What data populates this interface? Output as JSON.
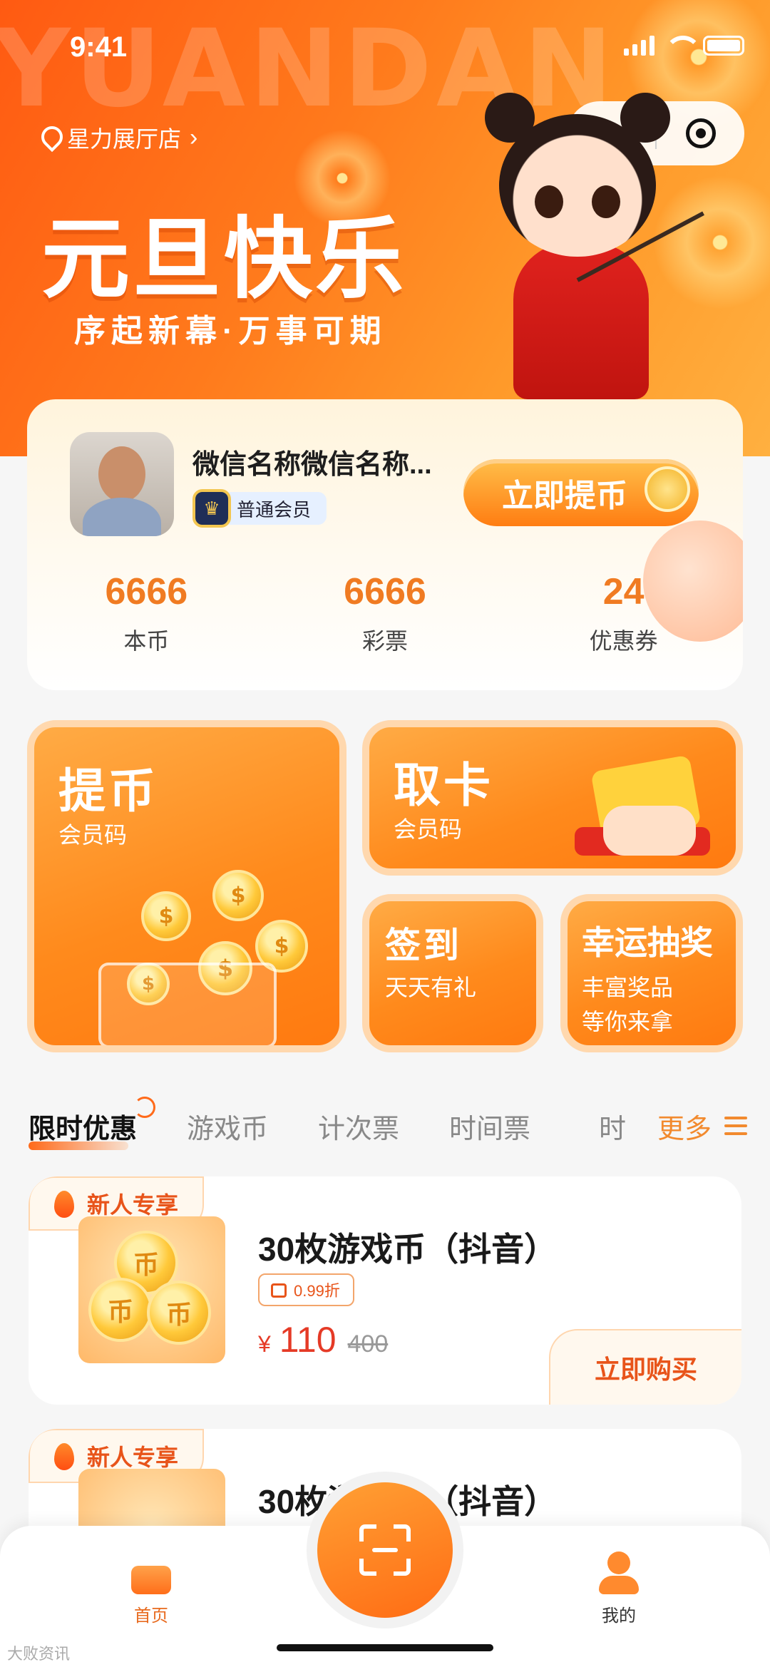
{
  "status_bar": {
    "time": "9:41"
  },
  "hero": {
    "bg_text": "YUANDAN",
    "store_name": "星力展厅店",
    "title": "元旦快乐",
    "subtitle": "序起新幕·万事可期"
  },
  "user": {
    "nickname": "微信名称微信名称...",
    "member_level": "普通会员",
    "withdraw_button": "立即提币",
    "stats": [
      {
        "value": "6666",
        "label": "本币"
      },
      {
        "value": "6666",
        "label": "彩票"
      },
      {
        "value": "24",
        "label": "优惠券"
      }
    ]
  },
  "features": {
    "withdraw": {
      "title": "提币",
      "subtitle": "会员码"
    },
    "card": {
      "title": "取卡",
      "subtitle": "会员码"
    },
    "signin": {
      "title": "签到",
      "subtitle": "天天有礼"
    },
    "lottery": {
      "title": "幸运抽奖",
      "subtitle_line1": "丰富奖品",
      "subtitle_line2": "等你来拿"
    }
  },
  "tabs": {
    "items": [
      "限时优惠",
      "游戏币",
      "计次票",
      "时间票"
    ],
    "cut_item": "时",
    "more_label": "更多"
  },
  "products": [
    {
      "tag": "新人专享",
      "name": "30枚游戏币（抖音）",
      "discount": "0.99折",
      "currency": "¥",
      "price": "110",
      "original_price": "400",
      "buy_label": "立即购买"
    },
    {
      "tag": "新人专享",
      "name": "30枚游戏币（抖音）"
    }
  ],
  "tabbar": {
    "home_label": "首页",
    "mine_label": "我的"
  },
  "watermark": "大败资讯",
  "colors": {
    "accent": "#ff7a1c",
    "price": "#e53a26",
    "tag_text": "#e8541a"
  }
}
